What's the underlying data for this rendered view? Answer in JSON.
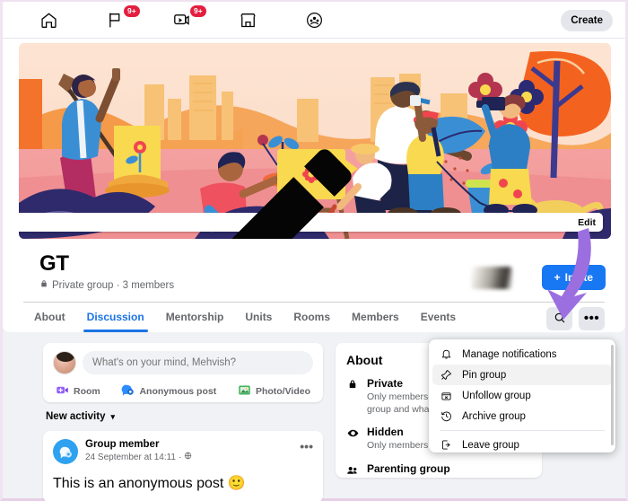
{
  "topnav": {
    "items": [
      {
        "name": "home",
        "icon": "home-icon",
        "badge": null
      },
      {
        "name": "pages",
        "icon": "flag-icon",
        "badge": "9+"
      },
      {
        "name": "watch",
        "icon": "video-icon",
        "badge": "9+"
      },
      {
        "name": "marketplace",
        "icon": "shop-icon",
        "badge": null
      },
      {
        "name": "groups",
        "icon": "groups-icon",
        "badge": null
      }
    ],
    "create_label": "Create"
  },
  "cover": {
    "edit_label": "Edit",
    "edit_icon": "pencil-icon",
    "alt": "community-garden-illustration"
  },
  "group": {
    "name": "GT",
    "privacy_icon": "lock-icon",
    "meta": "Private group · 3 members",
    "invite_label": "Invite",
    "invite_plus": "+"
  },
  "tabs": [
    {
      "label": "About",
      "active": false
    },
    {
      "label": "Discussion",
      "active": true
    },
    {
      "label": "Mentorship",
      "active": false
    },
    {
      "label": "Units",
      "active": false
    },
    {
      "label": "Rooms",
      "active": false
    },
    {
      "label": "Members",
      "active": false
    },
    {
      "label": "Events",
      "active": false
    }
  ],
  "tab_actions": {
    "search_icon": "search-icon",
    "more_icon": "ellipsis-icon",
    "more_glyph": "•••"
  },
  "composer": {
    "placeholder": "What's on your mind, Mehvish?",
    "value": "",
    "actions": [
      {
        "label": "Room",
        "icon": "room-icon",
        "color": "#9360f7"
      },
      {
        "label": "Anonymous post",
        "icon": "anonymous-icon",
        "color": "#2d8cff"
      },
      {
        "label": "Photo/Video",
        "icon": "photo-video-icon",
        "color": "#41b35d"
      }
    ]
  },
  "feed": {
    "sort_label": "New activity",
    "sort_caret": "▾",
    "post": {
      "author": "Group member",
      "timestamp": "24 September at 14:11",
      "separator": "·",
      "audience_icon": "globe-icon",
      "menu_glyph": "•••",
      "text": "This is an anonymous post 🙂"
    }
  },
  "about": {
    "title": "About",
    "rows": [
      {
        "icon": "lock-icon",
        "heading": "Private",
        "desc": "Only members can see who's in the group and what they post."
      },
      {
        "icon": "eye-icon",
        "heading": "Hidden",
        "desc": "Only members can find this group."
      },
      {
        "icon": "people-icon",
        "heading": "Parenting group",
        "desc": ""
      }
    ]
  },
  "dropdown": {
    "items": [
      {
        "label": "Manage notifications",
        "icon": "bell-icon",
        "highlighted": false
      },
      {
        "label": "Pin group",
        "icon": "pin-icon",
        "highlighted": true
      },
      {
        "label": "Unfollow group",
        "icon": "unfollow-icon",
        "highlighted": false
      },
      {
        "label": "Archive group",
        "icon": "archive-clock-icon",
        "highlighted": false
      },
      {
        "label": "Leave group",
        "icon": "leave-icon",
        "highlighted": false
      }
    ],
    "separator_after_index": 3
  },
  "annotation": {
    "arrow_icon": "purple-arrow-icon",
    "arrow_color": "#9b6fe0"
  },
  "colors": {
    "accent_blue": "#1877f2",
    "active_tab": "#1b74e4",
    "badge_red": "#e41e3f",
    "page_bg": "#f0f2f5",
    "card_bg": "#ffffff",
    "muted_text": "#65676b",
    "border_pink": "#efe2f0"
  }
}
